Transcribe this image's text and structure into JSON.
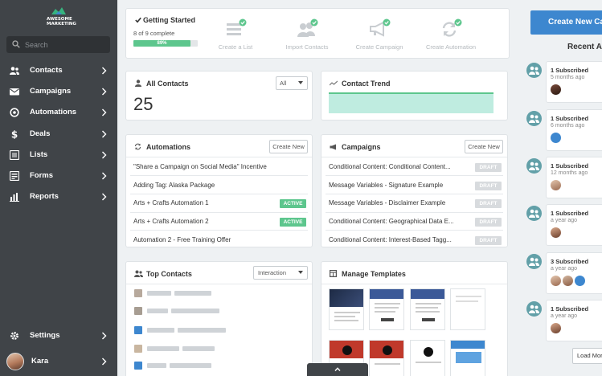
{
  "sidebar": {
    "logo_line1": "AWESOME",
    "logo_line2": "MARKETING",
    "search_placeholder": "Search",
    "items": [
      {
        "label": "Contacts",
        "icon": "contacts-icon"
      },
      {
        "label": "Campaigns",
        "icon": "envelope-icon"
      },
      {
        "label": "Automations",
        "icon": "automation-icon"
      },
      {
        "label": "Deals",
        "icon": "dollar-icon"
      },
      {
        "label": "Lists",
        "icon": "list-icon"
      },
      {
        "label": "Forms",
        "icon": "form-icon"
      },
      {
        "label": "Reports",
        "icon": "bar-chart-icon"
      }
    ],
    "settings_label": "Settings",
    "user_name": "Kara"
  },
  "getting_started": {
    "title": "Getting Started",
    "progress_text": "8 of 9 complete",
    "progress_percent_label": "89%",
    "progress_value": 0.89,
    "steps": [
      {
        "label": "Create a List",
        "done": true
      },
      {
        "label": "Import Contacts",
        "done": true
      },
      {
        "label": "Create Campaign",
        "done": true
      },
      {
        "label": "Create Automation",
        "done": true
      }
    ]
  },
  "all_contacts": {
    "title": "All Contacts",
    "count": "25",
    "filter_value": "All"
  },
  "contact_trend": {
    "title": "Contact Trend"
  },
  "automations": {
    "title": "Automations",
    "create_label": "Create New",
    "rows": [
      {
        "name": "\"Share a Campaign on Social Media\" Incentive",
        "status": ""
      },
      {
        "name": "Adding Tag: Alaska Package",
        "status": ""
      },
      {
        "name": "Arts + Crafts Automation 1",
        "status": "ACTIVE"
      },
      {
        "name": "Arts + Crafts Automation 2",
        "status": "ACTIVE"
      },
      {
        "name": "Automation 2 - Free Training Offer",
        "status": ""
      }
    ]
  },
  "campaigns": {
    "title": "Campaigns",
    "create_label": "Create New",
    "rows": [
      {
        "name": "Conditional Content: Conditional Content...",
        "status": "DRAFT"
      },
      {
        "name": "Message Variables - Signature Example",
        "status": "DRAFT"
      },
      {
        "name": "Message Variables - Disclaimer Example",
        "status": "DRAFT"
      },
      {
        "name": "Conditional Content: Geographical Data E...",
        "status": "DRAFT"
      },
      {
        "name": "Conditional Content: Interest-Based Tagg...",
        "status": "DRAFT"
      }
    ]
  },
  "top_contacts": {
    "title": "Top Contacts",
    "filter_value": "Interaction"
  },
  "manage_templates": {
    "title": "Manage Templates"
  },
  "right": {
    "create_button": "Create New Cam",
    "recent_title": "Recent A",
    "load_more": "Load Mor",
    "activities": [
      {
        "title": "1 Subscribed",
        "time": "5 months ago"
      },
      {
        "title": "1 Subscribed",
        "time": "6 months ago"
      },
      {
        "title": "1 Subscribed",
        "time": "12 months ago"
      },
      {
        "title": "1 Subscribed",
        "time": "a year ago"
      },
      {
        "title": "3 Subscribed",
        "time": "a year ago"
      },
      {
        "title": "1 Subscribed",
        "time": "a year ago"
      }
    ]
  },
  "colors": {
    "sidebar": "#404448",
    "accent_blue": "#3d87cf",
    "active_green": "#5dc68d",
    "progress_green": "#5dc68d",
    "trend_teal": "#bfece0",
    "activity_teal": "#62a0a8"
  }
}
